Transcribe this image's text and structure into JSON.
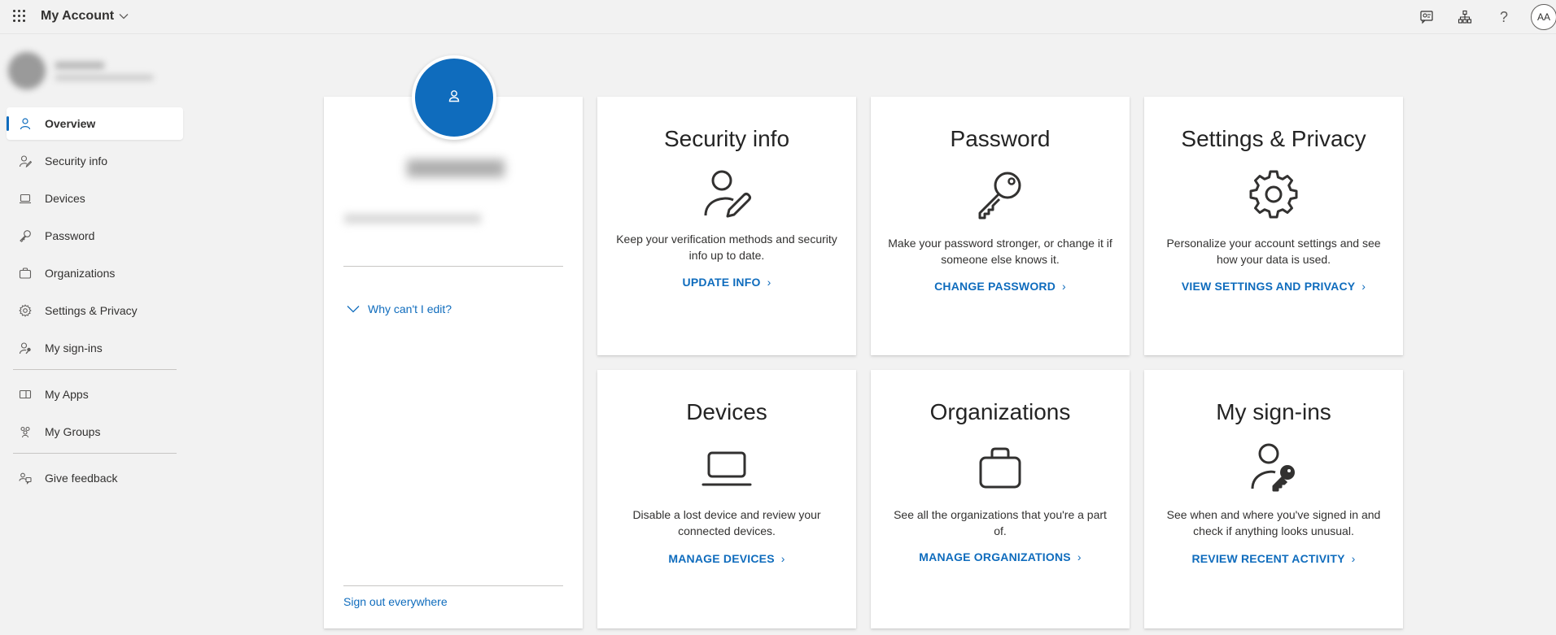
{
  "header": {
    "app_title": "My Account",
    "help_glyph": "?",
    "user_initials": "AA"
  },
  "sidebar": {
    "items": [
      {
        "label": "Overview",
        "icon": "person-icon",
        "active": true
      },
      {
        "label": "Security info",
        "icon": "person-edit-icon"
      },
      {
        "label": "Devices",
        "icon": "laptop-icon"
      },
      {
        "label": "Password",
        "icon": "key-icon"
      },
      {
        "label": "Organizations",
        "icon": "briefcase-icon"
      },
      {
        "label": "Settings & Privacy",
        "icon": "gear-icon"
      },
      {
        "label": "My sign-ins",
        "icon": "person-key-icon"
      }
    ],
    "apps": [
      {
        "label": "My Apps",
        "icon": "apps-icon"
      },
      {
        "label": "My Groups",
        "icon": "people-icon"
      }
    ],
    "feedback": {
      "label": "Give feedback",
      "icon": "feedback-icon"
    }
  },
  "profile": {
    "why_edit": "Why can't I edit?",
    "sign_out": "Sign out everywhere"
  },
  "cards": [
    {
      "title": "Security info",
      "desc": "Keep your verification methods and security info up to date.",
      "link": "UPDATE INFO",
      "icon": "person-edit-icon"
    },
    {
      "title": "Password",
      "desc": "Make your password stronger, or change it if someone else knows it.",
      "link": "CHANGE PASSWORD",
      "icon": "key-icon"
    },
    {
      "title": "Settings & Privacy",
      "desc": "Personalize your account settings and see how your data is used.",
      "link": "VIEW SETTINGS AND PRIVACY",
      "icon": "gear-icon"
    },
    {
      "title": "Devices",
      "desc": "Disable a lost device and review your connected devices.",
      "link": "MANAGE DEVICES",
      "icon": "laptop-icon"
    },
    {
      "title": "Organizations",
      "desc": "See all the organizations that you're a part of.",
      "link": "MANAGE ORGANIZATIONS",
      "icon": "briefcase-icon"
    },
    {
      "title": "My sign-ins",
      "desc": "See when and where you've signed in and check if anything looks unusual.",
      "link": "REVIEW RECENT ACTIVITY",
      "icon": "person-key-icon"
    }
  ],
  "colors": {
    "accent": "#0f6cbd",
    "background": "#f2f2f2",
    "card": "#ffffff"
  }
}
